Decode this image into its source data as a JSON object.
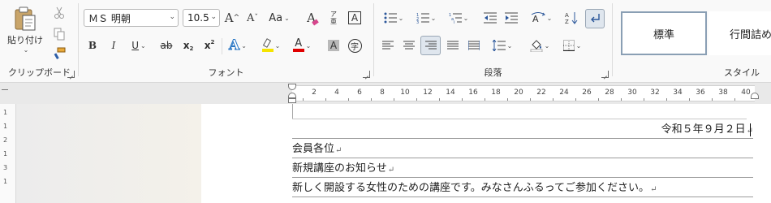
{
  "clipboard": {
    "paste_label": "貼り付け",
    "group_label": "クリップボード"
  },
  "font": {
    "name": "ＭＳ 明朝",
    "size": "10.5",
    "change_case_label": "Aa",
    "phonetic_char": "ア亜",
    "bold": "B",
    "italic": "I",
    "underline": "U",
    "strike": "ab",
    "subscript": "x",
    "subscript_mark": "2",
    "superscript": "x",
    "superscript_mark": "2",
    "grow": "A",
    "shrink": "A",
    "clear": "A",
    "border_char": "A",
    "effect": "A",
    "color": "A",
    "shading": "A",
    "enclose": "字",
    "group_label": "フォント"
  },
  "paragraph": {
    "group_label": "段落"
  },
  "styles": {
    "items": [
      "標準",
      "行間詰め"
    ],
    "group_label": "スタイル"
  },
  "ruler": {
    "numbers": [
      "2",
      "4",
      "6",
      "8",
      "10",
      "12",
      "14",
      "16",
      "18",
      "20",
      "22",
      "24",
      "26",
      "28",
      "30",
      "32",
      "34",
      "36",
      "38",
      "40"
    ]
  },
  "vruler": {
    "numbers": [
      "1",
      "1",
      "2",
      "1",
      "3",
      "1"
    ]
  },
  "document": {
    "lines": [
      "令和５年９月２日",
      "会員各位",
      "新規講座のお知らせ",
      "新しく開設する女性のための講座です。みなさんふるってご参加ください。"
    ],
    "return_mark": "↵"
  },
  "colors": {
    "highlight": "#f5e400",
    "font_color": "#e00000",
    "accent": "#2b579a"
  }
}
